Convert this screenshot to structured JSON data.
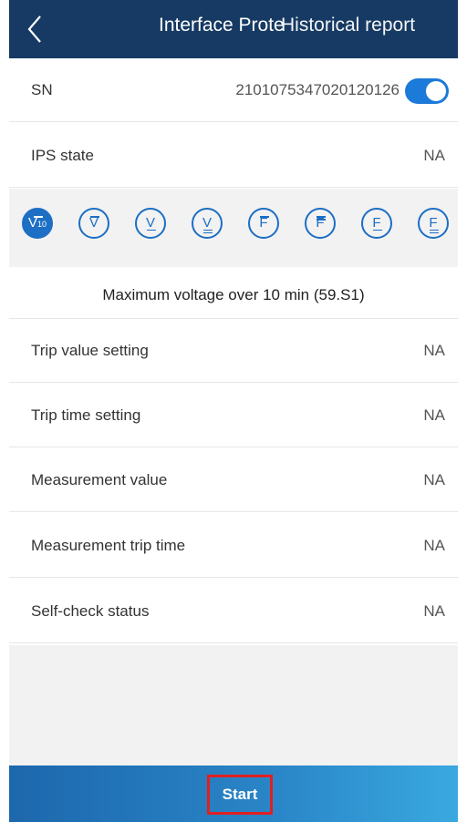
{
  "header": {
    "back_icon": "chevron-left-icon",
    "title_primary": "Interface Prote",
    "title_overlap": "Historical report"
  },
  "device": {
    "sn_label": "SN",
    "sn_value": "2101075347020120126",
    "sn_toggle_on": true
  },
  "ips_state": {
    "label": "IPS state",
    "value": "NA"
  },
  "protection_icons": [
    {
      "name": "v10-icon",
      "glyph": "V",
      "sub": "10",
      "active": true
    },
    {
      "name": "v-overline-icon",
      "glyph": "V",
      "active": false
    },
    {
      "name": "v-underline-icon",
      "glyph": "V",
      "active": false
    },
    {
      "name": "v-double-underline-icon",
      "glyph": "V",
      "active": false
    },
    {
      "name": "f-overline-icon",
      "glyph": "F",
      "active": false
    },
    {
      "name": "f-double-overline-icon",
      "glyph": "F",
      "active": false
    },
    {
      "name": "f-underline-icon",
      "glyph": "F",
      "active": false
    },
    {
      "name": "f-double-underline-icon",
      "glyph": "F",
      "active": false
    }
  ],
  "selected_description": "Maximum voltage over 10 min (59.S1)",
  "rows": [
    {
      "label": "Trip value setting",
      "value": "NA"
    },
    {
      "label": "Trip time setting",
      "value": "NA"
    },
    {
      "label": "Measurement value",
      "value": "NA"
    },
    {
      "label": "Measurement trip time",
      "value": "NA"
    },
    {
      "label": "Self-check status",
      "value": "NA"
    }
  ],
  "footer": {
    "start_label": "Start"
  },
  "colors": {
    "header_bg": "#163a63",
    "accent": "#1c6fc4",
    "highlight_border": "#e02020"
  }
}
